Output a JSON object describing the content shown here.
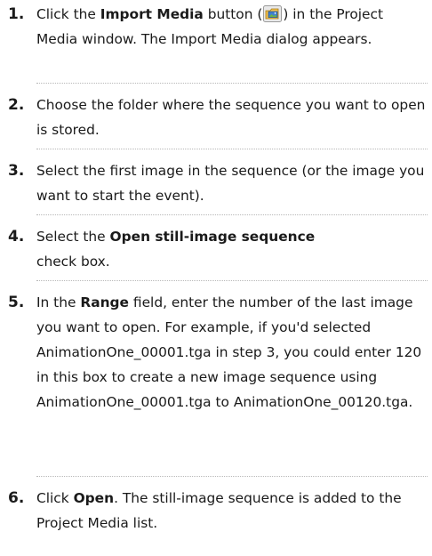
{
  "steps": [
    {
      "number": "1.",
      "t1": "Click the ",
      "b1": "Import Media",
      "t2": " button (",
      "icon": "import-media-icon",
      "t3": ") in the Project Media window. The Import Media dialog appears."
    },
    {
      "number": "2.",
      "text": "Choose the folder where the sequence you want to open is stored."
    },
    {
      "number": "3.",
      "text": "Select the first image in the sequence (or the image you want to start the event)."
    },
    {
      "number": "4.",
      "t1": "Select the ",
      "b1": "Open still-image sequence",
      "t2": " check box."
    },
    {
      "number": "5.",
      "t1": "In the ",
      "b1": "Range",
      "t2": " field, enter the number of the last image you want to open. For example, if you'd selected AnimationOne_00001.tga in step 3, you could enter 120 in this box to create a new image sequence using AnimationOne_00001.tga to AnimationOne_00120.tga."
    },
    {
      "number": "6.",
      "t1": "Click ",
      "b1": "Open",
      "t2": ". The still-image sequence is added to the Project Media list."
    }
  ]
}
